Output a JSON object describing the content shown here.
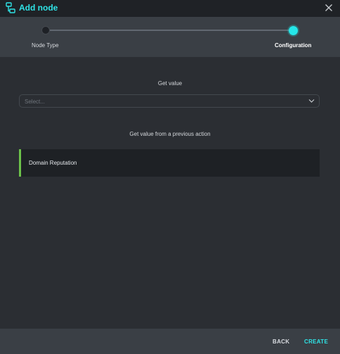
{
  "header": {
    "title": "Add node",
    "icon": "node-graph-icon",
    "close_icon": "close-icon",
    "accent_color": "#2fe3e6"
  },
  "stepper": {
    "steps": [
      {
        "label": "Node Type",
        "state": "completed"
      },
      {
        "label": "Configuration",
        "state": "active"
      }
    ],
    "active_color": "#25e6e8"
  },
  "form": {
    "get_value_label": "Get value",
    "select": {
      "placeholder": "Select...",
      "icon": "chevron-down-icon"
    },
    "previous_action_label": "Get value from a previous action",
    "actions": [
      {
        "label": "Domain Reputation",
        "accent": "#6cc24a"
      }
    ]
  },
  "footer": {
    "back_label": "BACK",
    "create_label": "CREATE"
  }
}
